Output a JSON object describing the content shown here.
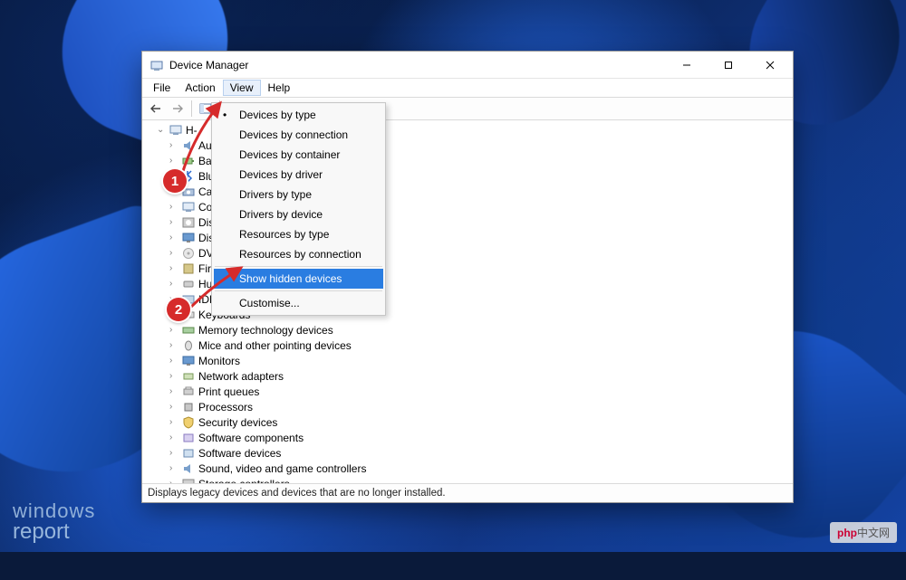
{
  "window": {
    "title": "Device Manager"
  },
  "menubar": [
    "File",
    "Action",
    "View",
    "Help"
  ],
  "menubar_active_index": 2,
  "view_menu": {
    "items": [
      "Devices by type",
      "Devices by connection",
      "Devices by container",
      "Devices by driver",
      "Drivers by type",
      "Drivers by device",
      "Resources by type",
      "Resources by connection",
      "Show hidden devices",
      "Customise..."
    ],
    "selected_mode_index": 0,
    "highlighted_index": 8,
    "separator_before": [
      8,
      9
    ]
  },
  "tree": {
    "root": "H-",
    "children": [
      {
        "icon": "audio",
        "label": "Aud"
      },
      {
        "icon": "battery",
        "label": "Batt"
      },
      {
        "icon": "bluetooth",
        "label": "Blue"
      },
      {
        "icon": "camera",
        "label": "Cam"
      },
      {
        "icon": "computer",
        "label": "Com"
      },
      {
        "icon": "disk",
        "label": "Disk"
      },
      {
        "icon": "display",
        "label": "Disp"
      },
      {
        "icon": "dvd",
        "label": "DVD"
      },
      {
        "icon": "firmware",
        "label": "Firm"
      },
      {
        "icon": "hid",
        "label": "Hun"
      },
      {
        "icon": "ide",
        "label": "IDE A..."
      },
      {
        "icon": "keyboard",
        "label": "Keyboards"
      },
      {
        "icon": "memory",
        "label": "Memory technology devices"
      },
      {
        "icon": "mouse",
        "label": "Mice and other pointing devices"
      },
      {
        "icon": "monitor",
        "label": "Monitors"
      },
      {
        "icon": "network",
        "label": "Network adapters"
      },
      {
        "icon": "printqueue",
        "label": "Print queues"
      },
      {
        "icon": "processor",
        "label": "Processors"
      },
      {
        "icon": "security",
        "label": "Security devices"
      },
      {
        "icon": "swcomp",
        "label": "Software components"
      },
      {
        "icon": "swdev",
        "label": "Software devices"
      },
      {
        "icon": "sound",
        "label": "Sound, video and game controllers"
      },
      {
        "icon": "storage",
        "label": "Storage controllers"
      }
    ]
  },
  "statusbar": "Displays legacy devices and devices that are no longer installed.",
  "annotations": {
    "badge1": "1",
    "badge2": "2"
  },
  "watermark_left": {
    "line1": "windows",
    "line2": "report"
  },
  "watermark_right": {
    "prefix": "php",
    "suffix": "中文网"
  }
}
